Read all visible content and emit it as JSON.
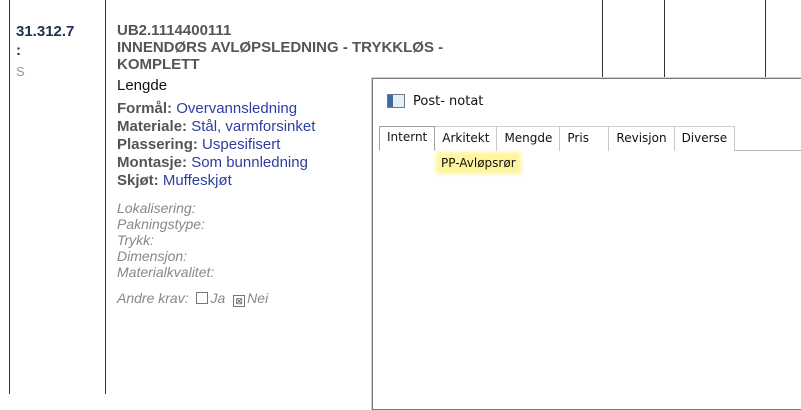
{
  "row": {
    "code": "31.312.7",
    "code_mark": ":",
    "code_status": "S",
    "ref": "UB2.1114400111",
    "title_line1": "INNENDØRS AVLØPSLEDNING - TRYKKLØS -",
    "title_line2": "KOMPLETT",
    "unit": "Lengde",
    "properties": [
      {
        "key": "Formål:",
        "value": "Overvannsledning"
      },
      {
        "key": "Materiale:",
        "value": "Stål, varmforsinket"
      },
      {
        "key": "Plassering:",
        "value": "Uspesifisert"
      },
      {
        "key": "Montasje:",
        "value": "Som bunnledning"
      },
      {
        "key": "Skjøt:",
        "value": "Muffeskjøt"
      }
    ],
    "extra_fields": [
      "Lokalisering:",
      "Pakningstype:",
      "Trykk:",
      "Dimensjon:",
      "Materialkvalitet:"
    ],
    "krav": {
      "label": "Andre krav:",
      "ja": "Ja",
      "nei": "Nei",
      "nei_mark": "⊠"
    }
  },
  "dialog": {
    "title": "Post- notat",
    "tabs": [
      "Internt",
      "Arkitekt",
      "Mengde",
      "Pris",
      "Revisjon",
      "Diverse"
    ],
    "note_text": "PP-Avløpsrør",
    "highlight_color": "#fff59d"
  }
}
